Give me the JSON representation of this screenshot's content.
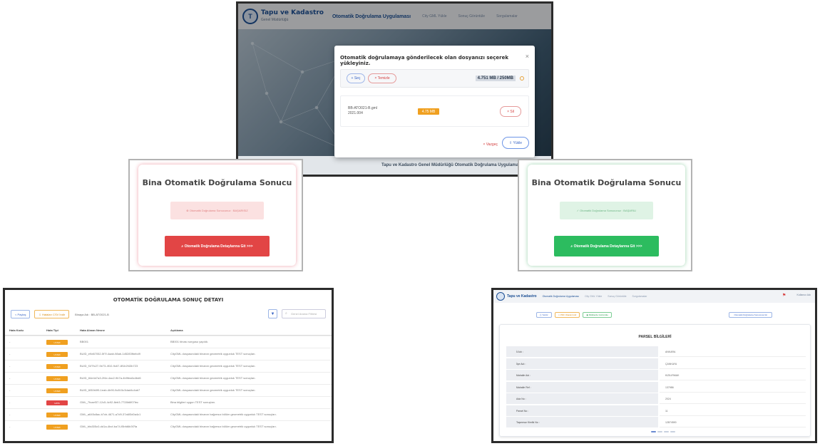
{
  "upload_panel": {
    "brand": "Tapu ve Kadastro",
    "brand_sub": "Genel Müdürlüğü",
    "nav_title": "Otomatik Doğrulama Uygulaması",
    "nav_items": [
      "City GML Yükle",
      "Sonuç Görüntüle",
      "Sorgulamalar"
    ],
    "footer": "Tapu ve Kadastro Genel Müdürlüğü Otomatik Doğrulama Uygulaması",
    "modal": {
      "title": "Otomatik doğrulamaya gönderilecek olan dosyanızı seçerek yükleyiniz.",
      "close": "×",
      "select_label": "Seç",
      "clear_label": "Temizle",
      "size_info": "4.751 MB / 250MB",
      "file_name": "BB-ATO021-B.gml",
      "file_date": "2021.004",
      "file_size": "4.75 MB",
      "delete_label": "Sil",
      "cancel_label": "Vazgeç",
      "upload_label": "Yükle"
    }
  },
  "result_fail": {
    "title": "Bina Otomatik Doğrulama Sonucu",
    "status": "Otomatik Doğrulama Sonucunuz : BAŞARISIZ",
    "button": "Otomatik Doğrulama Detaylarına Git >>>"
  },
  "result_success": {
    "title": "Bina Otomatik Doğrulama Sonucu",
    "status": "Otomatik Doğrulama Sonucunuz : BAŞARILI",
    "button": "Otomatik Doğrulama Detaylarına Git >>>"
  },
  "detail_panel": {
    "title": "OTOMATİK DOĞRULAMA SONUÇ DETAYI",
    "share_label": "Paylaş",
    "excel_label": "Hataları CSV İndir",
    "bina_label": "Binaya Adı : BB-ATO021-B",
    "search_placeholder": "Genel Arama Filtresi",
    "columns": [
      "Hata Kodu",
      "Hata Tipi",
      "Hata Alınan Nesne",
      "Açıklama"
    ],
    "rows": [
      {
        "code": "-",
        "type": "UYARI",
        "kind": "w",
        "object": "BB001",
        "desc": "BB001 binası sorgusu yapıldı."
      },
      {
        "code": "-",
        "type": "UYARI",
        "kind": "w",
        "object": "BUID_e9d67052-5f7f-4aab-98ab-1d5283fbebd9",
        "desc": "CityGML dosyasındaki binanın geometrik uygunluk TEST sonuçları."
      },
      {
        "code": "-",
        "type": "UYARI",
        "kind": "w",
        "object": "BUID_f1f7fc27-9e73-4f10-9c67-8f1b2f43b723",
        "desc": "CityGML dosyasındaki binanın geometrik uygunluk TEST sonuçları."
      },
      {
        "code": "-",
        "type": "UYARI",
        "kind": "w",
        "object": "BUID_84e4d7a3-2f4e-4ac2-9b7a-4b9fea6c4bd6",
        "desc": "CityGML dosyasındaki binanın geometrik uygunluk TEST sonuçları."
      },
      {
        "code": "-",
        "type": "UYARI",
        "kind": "w",
        "object": "BUID_6f30b0f9-1eab-4b90-9c8f-5c3dad4c4ab7",
        "desc": "CityGML dosyasındaki binanın geometrik uygunluk TEST sonuçları."
      },
      {
        "code": "-",
        "type": "HATA",
        "kind": "e",
        "object": "GML_7fcaef37-12c5-4c92-8eb3-7728b6f07fec",
        "desc": "Bina bilgileri uygun TEST sonuçları."
      },
      {
        "code": "-",
        "type": "UYARI",
        "kind": "w",
        "object": "GML_a645c8ac-b7cb-4671-a7d9-37a6f3d0a4c1",
        "desc": "CityGML dosyasındaki binanın bağımsız bölüm geometrik uygunluk TEST sonuçları."
      },
      {
        "code": "-",
        "type": "UYARI",
        "kind": "w",
        "object": "GML_bfa305c0-dd1a-4bcf-ba74-f5bfd6b3f7fa",
        "desc": "CityGML dosyasındaki binanın bağımsız bölüm geometrik uygunluk TEST sonuçları."
      }
    ]
  },
  "parcel_panel": {
    "brand": "Tapu ve Kadastro",
    "nav_title": "Otomatik Doğrulama Uygulaması",
    "nav_items": [
      "City GML Yükle",
      "Sonuç Görüntüle",
      "Sorgulamalar"
    ],
    "user": "Kullanıcı Adı",
    "actions": [
      "Yazdır",
      "PDF Olarak İndir",
      "Mülklerde Görüntüle"
    ],
    "right_action": "Otomatik Doğrulama Sonucuna Git",
    "title": "PARSEL BİLGİLERİ",
    "rows": [
      {
        "k": "İl Adı :",
        "v": "ANKARA"
      },
      {
        "k": "İlçe Adı :",
        "v": "ÇANKAYA"
      },
      {
        "k": "Mahalle Adı :",
        "v": "KIZILIRMAK"
      },
      {
        "k": "Mahalle Ref :",
        "v": "137986"
      },
      {
        "k": "Ada No :",
        "v": "2024"
      },
      {
        "k": "Parsel No :",
        "v": "11"
      },
      {
        "k": "Taşınmaz Kimlik No :",
        "v": "12874590"
      }
    ]
  }
}
